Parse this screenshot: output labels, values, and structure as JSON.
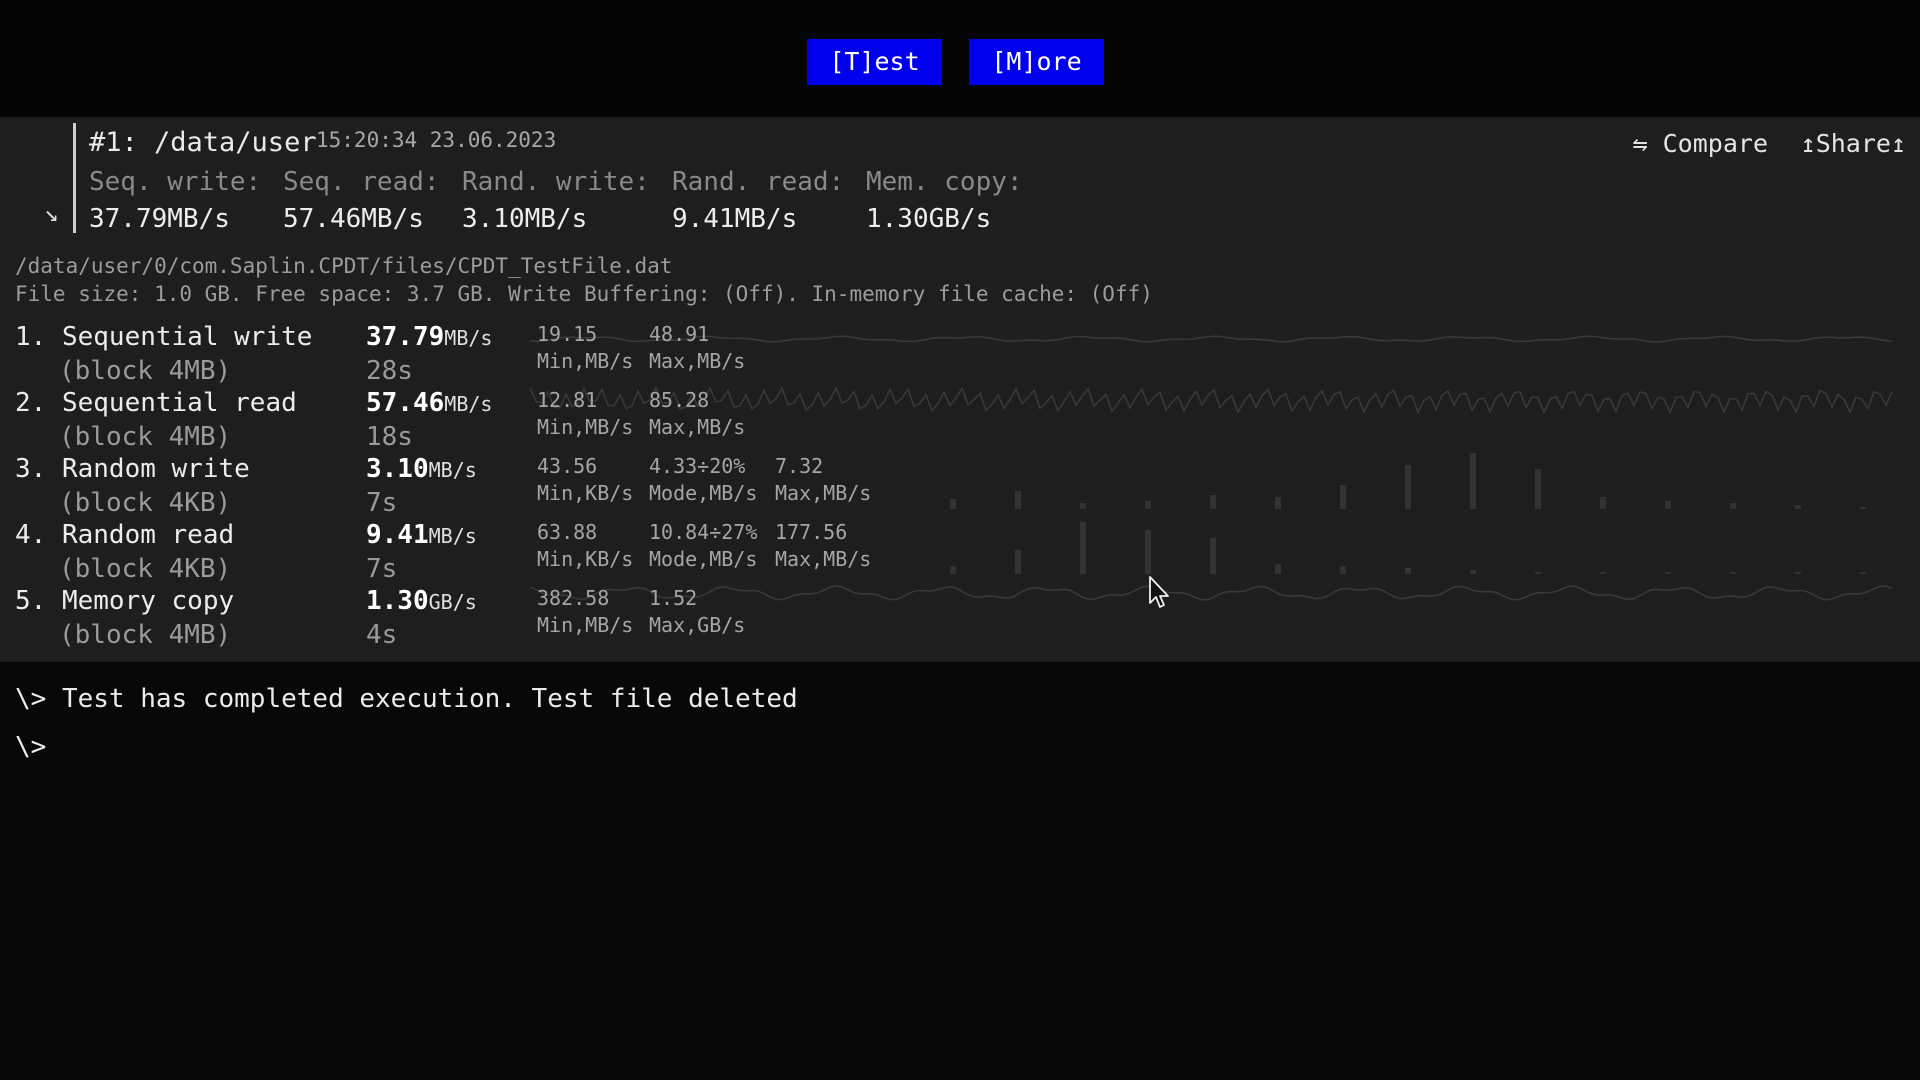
{
  "toolbar": {
    "test_label": "[T]est",
    "more_label": "[M]ore"
  },
  "summary": {
    "title": "#1: /data/user",
    "timestamp": "15:20:34 23.06.2023",
    "columns": [
      {
        "label": "Seq. write:",
        "value": "37.79MB/s"
      },
      {
        "label": "Seq. read:",
        "value": "57.46MB/s"
      },
      {
        "label": "Rand. write:",
        "value": "3.10MB/s"
      },
      {
        "label": "Rand. read:",
        "value": "9.41MB/s"
      },
      {
        "label": "Mem. copy:",
        "value": "1.30GB/s"
      }
    ],
    "compare_label": "⇋ Compare",
    "share_label": "↥Share↥"
  },
  "file_path": "/data/user/0/com.Saplin.CPDT/files/CPDT_TestFile.dat",
  "file_info": "File size: 1.0 GB. Free space: 3.7 GB. Write Buffering: (Off). In-memory file cache: (Off)",
  "tests": [
    {
      "name": "1. Sequential write",
      "block": "(block 4MB)",
      "speed": "37.79",
      "unit": "MB/s",
      "duration": "28s",
      "stats": [
        {
          "value": "19.15",
          "label": "Min,MB/s"
        },
        {
          "value": "48.91",
          "label": "Max,MB/s"
        }
      ]
    },
    {
      "name": "2. Sequential read",
      "block": "(block 4MB)",
      "speed": "57.46",
      "unit": "MB/s",
      "duration": "18s",
      "stats": [
        {
          "value": "12.81",
          "label": "Min,MB/s"
        },
        {
          "value": "85.28",
          "label": "Max,MB/s"
        }
      ]
    },
    {
      "name": "3. Random write",
      "block": "(block 4KB)",
      "speed": "3.10",
      "unit": "MB/s",
      "duration": "7s",
      "stats": [
        {
          "value": "43.56",
          "label": "Min,KB/s"
        },
        {
          "value": "4.33÷20%",
          "label": "Mode,MB/s"
        },
        {
          "value": "7.32",
          "label": "Max,MB/s"
        }
      ]
    },
    {
      "name": "4. Random read",
      "block": "(block 4KB)",
      "speed": "9.41",
      "unit": "MB/s",
      "duration": "7s",
      "stats": [
        {
          "value": "63.88",
          "label": "Min,KB/s"
        },
        {
          "value": "10.84÷27%",
          "label": "Mode,MB/s"
        },
        {
          "value": "177.56",
          "label": "Max,MB/s"
        }
      ]
    },
    {
      "name": "5. Memory copy",
      "block": "(block 4MB)",
      "speed": "1.30",
      "unit": "GB/s",
      "duration": "4s",
      "stats": [
        {
          "value": "382.58",
          "label": "Min,MB/s"
        },
        {
          "value": "1.52",
          "label": "Max,GB/s"
        }
      ]
    }
  ],
  "console": {
    "line1": "\\> Test has completed execution. Test file deleted",
    "prompt": "\\>"
  },
  "colors": {
    "accent": "#0000ee",
    "panel": "#1e1e1e",
    "background": "#080808"
  },
  "icons": {
    "collapse": "arrow-down-right-icon",
    "compare": "swap-icon",
    "share": "share-icon"
  }
}
